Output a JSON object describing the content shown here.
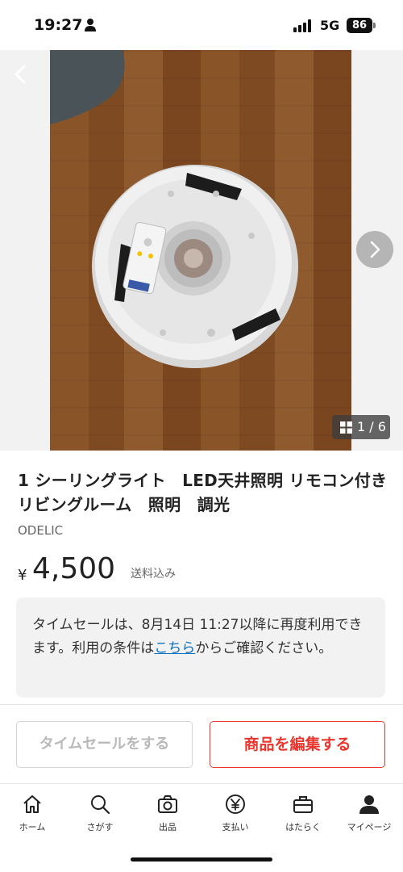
{
  "status_bar": {
    "time": "19:27",
    "network": "5G",
    "battery": "86"
  },
  "gallery": {
    "counter": "1 / 6"
  },
  "product": {
    "title": "1 シーリングライト　LED天井照明 リモコン付き　リビングルーム　照明　調光",
    "brand": "ODELIC",
    "price_symbol": "¥",
    "price": "4,500",
    "shipping_note": "送料込み"
  },
  "notice": {
    "text_before_link": "タイムセールは、8月14日 11:27以降に再度利用できます。利用の条件は",
    "link": "こちら",
    "text_after_link": "からご確認ください。"
  },
  "actions": {
    "timesale_label": "タイムセールをする",
    "edit_label": "商品を編集する"
  },
  "tabs": [
    {
      "label": "ホーム",
      "icon": "home-icon"
    },
    {
      "label": "さがす",
      "icon": "search-icon"
    },
    {
      "label": "出品",
      "icon": "camera-icon"
    },
    {
      "label": "支払い",
      "icon": "yen-icon"
    },
    {
      "label": "はたらく",
      "icon": "briefcase-icon"
    },
    {
      "label": "マイページ",
      "icon": "person-icon"
    }
  ],
  "colors": {
    "accent": "#ea352d",
    "link": "#0a6fbf"
  }
}
